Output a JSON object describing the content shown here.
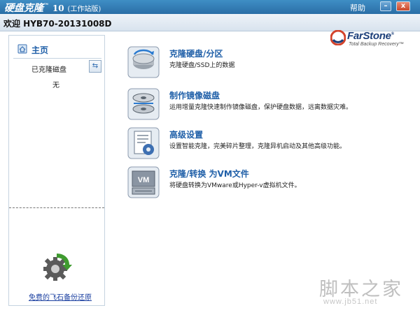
{
  "window": {
    "title": "硬盘克隆",
    "title_tm": "™",
    "version": "10",
    "edition": "(工作站版)",
    "help": "帮助",
    "minimize": "–",
    "close": "x"
  },
  "header": {
    "welcome": "欢迎 HYB70-20131008D"
  },
  "logo": {
    "name": "FarStone",
    "registered": "®",
    "tagline": "Total Backup Recovery™"
  },
  "sidebar": {
    "home": "主页",
    "cloned_disk": "已克隆磁盘",
    "none": "无",
    "free_link": "免费的飞石备份还原"
  },
  "tasks": [
    {
      "title": "克隆硬盘/分区",
      "desc": "克隆硬盘/SSD上的数据",
      "icon": "clone-disk-icon"
    },
    {
      "title": "制作镜像磁盘",
      "desc": "运用增量克隆快速制作镜像磁盘，保护硬盘数据，远离数据灾难。",
      "icon": "mirror-disk-icon"
    },
    {
      "title": "高级设置",
      "desc": "设置智能克隆，完美碎片整理，克隆异机启动及其他高级功能。",
      "icon": "settings-icon"
    },
    {
      "title": "克隆/转换 为VM文件",
      "desc": "将硬盘转换为VMware或Hyper-v虚拟机文件。",
      "icon": "vm-convert-icon"
    }
  ],
  "watermark": {
    "cn": "脚本之家",
    "url": "www.jb51.net"
  },
  "colors": {
    "titlebar": "#2a6ea6",
    "link": "#1f5fa8",
    "border": "#c5d3e0"
  }
}
